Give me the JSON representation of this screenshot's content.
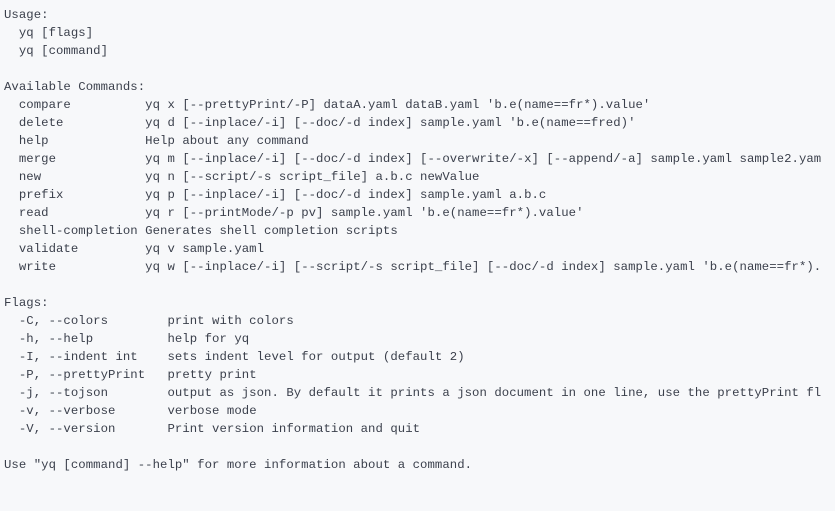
{
  "usage": {
    "header": "Usage:",
    "lines": [
      "yq [flags]",
      "yq [command]"
    ]
  },
  "commands": {
    "header": "Available Commands:",
    "items": [
      {
        "name": "compare",
        "desc": "yq x [--prettyPrint/-P] dataA.yaml dataB.yaml 'b.e(name==fr*).value'"
      },
      {
        "name": "delete",
        "desc": "yq d [--inplace/-i] [--doc/-d index] sample.yaml 'b.e(name==fred)'"
      },
      {
        "name": "help",
        "desc": "Help about any command"
      },
      {
        "name": "merge",
        "desc": "yq m [--inplace/-i] [--doc/-d index] [--overwrite/-x] [--append/-a] sample.yaml sample2.yam"
      },
      {
        "name": "new",
        "desc": "yq n [--script/-s script_file] a.b.c newValue"
      },
      {
        "name": "prefix",
        "desc": "yq p [--inplace/-i] [--doc/-d index] sample.yaml a.b.c"
      },
      {
        "name": "read",
        "desc": "yq r [--printMode/-p pv] sample.yaml 'b.e(name==fr*).value'"
      },
      {
        "name": "shell-completion",
        "desc": "Generates shell completion scripts"
      },
      {
        "name": "validate",
        "desc": "yq v sample.yaml"
      },
      {
        "name": "write",
        "desc": "yq w [--inplace/-i] [--script/-s script_file] [--doc/-d index] sample.yaml 'b.e(name==fr*)."
      }
    ]
  },
  "flags": {
    "header": "Flags:",
    "items": [
      {
        "flag": "-C, --colors",
        "desc": "print with colors"
      },
      {
        "flag": "-h, --help",
        "desc": "help for yq"
      },
      {
        "flag": "-I, --indent int",
        "desc": "sets indent level for output (default 2)"
      },
      {
        "flag": "-P, --prettyPrint",
        "desc": "pretty print"
      },
      {
        "flag": "-j, --tojson",
        "desc": "output as json. By default it prints a json document in one line, use the prettyPrint fl"
      },
      {
        "flag": "-v, --verbose",
        "desc": "verbose mode"
      },
      {
        "flag": "-V, --version",
        "desc": "Print version information and quit"
      }
    ]
  },
  "footer": "Use \"yq [command] --help\" for more information about a command."
}
